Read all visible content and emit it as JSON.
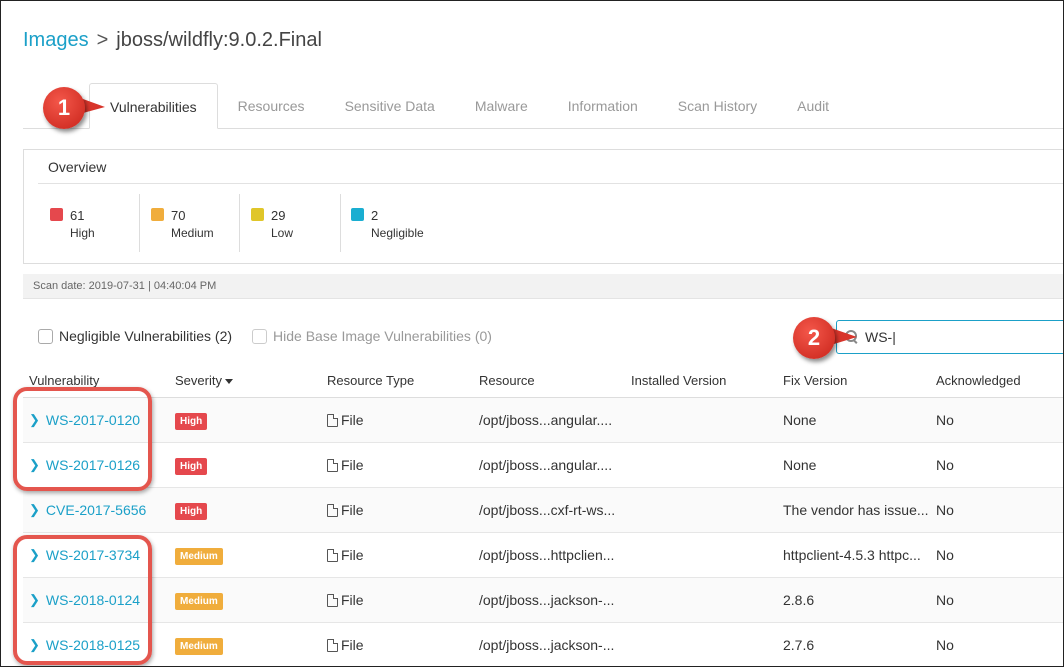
{
  "breadcrumb": {
    "root": "Images",
    "separator": ">",
    "current": "jboss/wildfly:9.0.2.Final"
  },
  "tabs": [
    "Vulnerabilities",
    "Resources",
    "Sensitive Data",
    "Malware",
    "Information",
    "Scan History",
    "Audit"
  ],
  "active_tab": "Vulnerabilities",
  "overview": {
    "title": "Overview",
    "severities": [
      {
        "count": "61",
        "label": "High",
        "color": "#e5484d"
      },
      {
        "count": "70",
        "label": "Medium",
        "color": "#f0ad3c"
      },
      {
        "count": "29",
        "label": "Low",
        "color": "#e0c629"
      },
      {
        "count": "2",
        "label": "Negligible",
        "color": "#1aaed1"
      }
    ]
  },
  "scan_date": "Scan date: 2019-07-31 | 04:40:04 PM",
  "filters": {
    "negligible": "Negligible Vulnerabilities (2)",
    "hide_base": "Hide Base Image Vulnerabilities (0)"
  },
  "search": {
    "value": "WS-|",
    "icon": "search-icon"
  },
  "table": {
    "columns": [
      "Vulnerability",
      "Severity",
      "Resource Type",
      "Resource",
      "Installed Version",
      "Fix Version",
      "Acknowledged"
    ],
    "rows": [
      {
        "id": "WS-2017-0120",
        "severity": "High",
        "type": "File",
        "resource": "/opt/jboss...angular....",
        "installed": "",
        "fix": "None",
        "ack": "No"
      },
      {
        "id": "WS-2017-0126",
        "severity": "High",
        "type": "File",
        "resource": "/opt/jboss...angular....",
        "installed": "",
        "fix": "None",
        "ack": "No"
      },
      {
        "id": "CVE-2017-5656",
        "severity": "High",
        "type": "File",
        "resource": "/opt/jboss...cxf-rt-ws...",
        "installed": "",
        "fix": "The vendor has issue...",
        "ack": "No"
      },
      {
        "id": "WS-2017-3734",
        "severity": "Medium",
        "type": "File",
        "resource": "/opt/jboss...httpclien...",
        "installed": "",
        "fix": "httpclient-4.5.3 httpc...",
        "ack": "No"
      },
      {
        "id": "WS-2018-0124",
        "severity": "Medium",
        "type": "File",
        "resource": "/opt/jboss...jackson-...",
        "installed": "",
        "fix": "2.8.6",
        "ack": "No"
      },
      {
        "id": "WS-2018-0125",
        "severity": "Medium",
        "type": "File",
        "resource": "/opt/jboss...jackson-...",
        "installed": "",
        "fix": "2.7.6",
        "ack": "No"
      }
    ]
  },
  "severity_colors": {
    "High": "#e5484d",
    "Medium": "#f0ad3c"
  },
  "callouts": [
    "1",
    "2"
  ],
  "accent_color": "#1ba0c8",
  "annotation_color": "#e4564e"
}
